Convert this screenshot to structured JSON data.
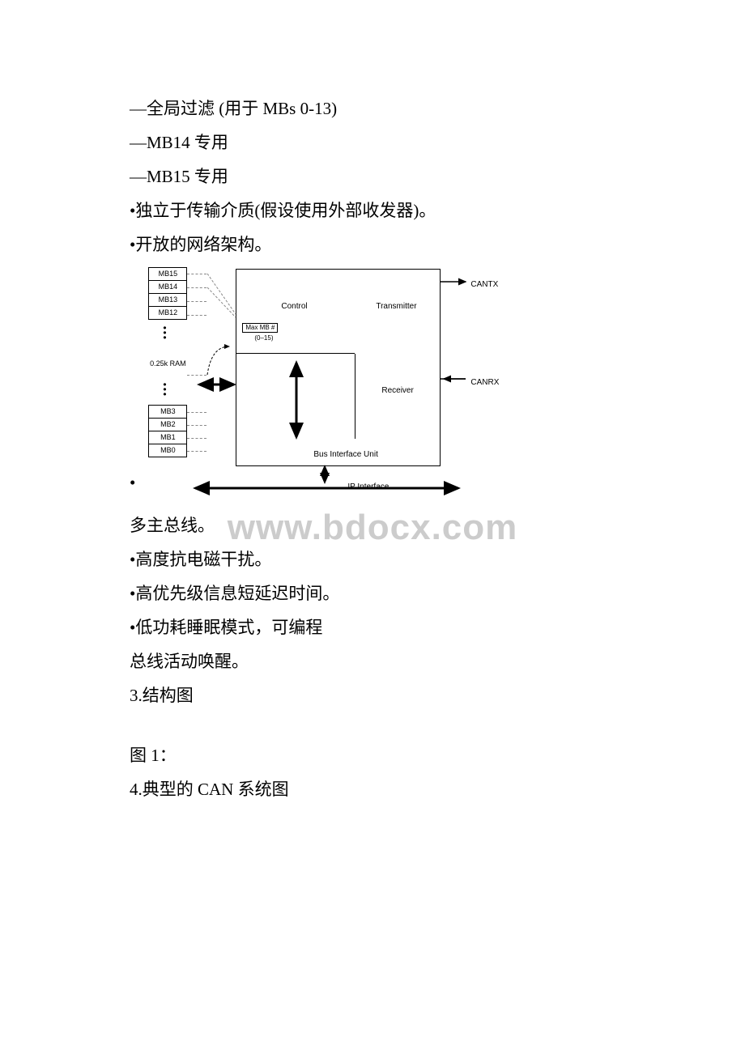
{
  "lines": {
    "l1": "—全局过滤 (用于 MBs 0-13)",
    "l2": "—MB14 专用",
    "l3": "—MB15 专用",
    "l4": "•独立于传输介质(假设使用外部收发器)。",
    "l5": "•开放的网络架构。",
    "l6": "多主总线。",
    "l7": "•高度抗电磁干扰。",
    "l8": "•高优先级信息短延迟时间。",
    "l9": "•低功耗睡眠模式，可编程",
    "l10": "总线活动唤醒。",
    "l11": "3.结构图",
    "l12": "图 1：",
    "l13": "4.典型的 CAN 系统图"
  },
  "diagram": {
    "mb15": "MB15",
    "mb14": "MB14",
    "mb13": "MB13",
    "mb12": "MB12",
    "mb3": "MB3",
    "mb2": "MB2",
    "mb1": "MB1",
    "mb0": "MB0",
    "ram": "0.25k RAM",
    "control": "Control",
    "transmitter": "Transmitter",
    "receiver": "Receiver",
    "bus": "Bus Interface Unit",
    "maxmb": "Max MB #",
    "maxmb_range": "(0–15)",
    "cantx": "CANTX",
    "canrx": "CANRX",
    "ip": "IP Interface"
  },
  "watermark": "www.bdocx.com",
  "bullet": "•"
}
